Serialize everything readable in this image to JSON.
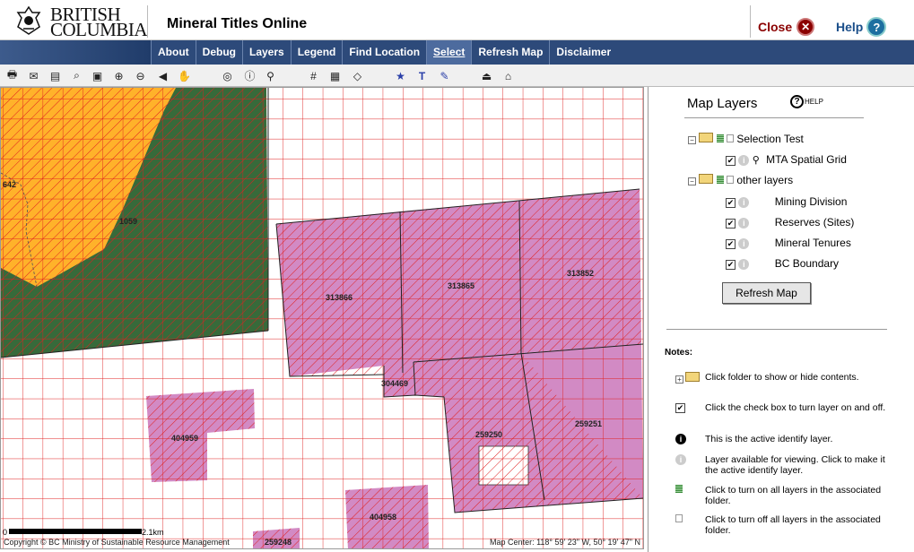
{
  "header": {
    "logo_line1": "BRITISH",
    "logo_line2": "COLUMBIA",
    "app_title": "Mineral Titles Online",
    "close_label": "Close",
    "help_label": "Help"
  },
  "nav": {
    "items": [
      "About",
      "Debug",
      "Layers",
      "Legend",
      "Find Location",
      "Select",
      "Refresh Map",
      "Disclaimer"
    ],
    "active": "Select"
  },
  "toolbar": {
    "tools": [
      "print-icon",
      "email-icon",
      "legend-icon",
      "find-icon",
      "select-icon",
      "zoom-in-icon",
      "zoom-out-icon",
      "back-icon",
      "pan-icon",
      "identify-icon",
      "info-icon",
      "magic-icon",
      "grid-icon",
      "grid-select-icon",
      "eraser-icon",
      "star-icon",
      "text-icon",
      "pin-icon",
      "measure-icon",
      "lock-icon"
    ]
  },
  "map": {
    "labels": {
      "l642": "642",
      "l1059": "1059",
      "l313866": "313866",
      "l313865": "313865",
      "l313852": "313852",
      "l304469": "304469",
      "l404959": "404959",
      "l259250": "259250",
      "l259251": "259251",
      "l404958": "404958",
      "l259248": "259248"
    },
    "scale_start": "0",
    "scale_end": "2.1km",
    "copyright": "Copyright © BC Ministry of Sustainable Resource Management",
    "center": "Map Center: 118° 59' 23\" W, 50° 19' 47\" N",
    "colors": {
      "yellow": "#ffb22a",
      "green": "#376a3a",
      "pink": "#d28ac4",
      "grid": "#e02020"
    }
  },
  "panel": {
    "title": "Map Layers",
    "help": "HELP",
    "folder1": "Selection Test",
    "layer1": "MTA Spatial Grid",
    "folder2": "other layers",
    "layer2": "Mining Division",
    "layer3": "Reserves (Sites)",
    "layer4": "Mineral Tenures",
    "layer5": "BC Boundary",
    "refresh": "Refresh Map",
    "notes_title": "Notes:",
    "notes": [
      "Click folder to show or hide contents.",
      "Click the check box to turn layer on and off.",
      "This is the active identify layer.",
      "Layer available for viewing. Click to make it the active identify layer.",
      "Click to turn on all layers in the associated folder.",
      "Click to turn off all layers in the associated folder."
    ]
  }
}
